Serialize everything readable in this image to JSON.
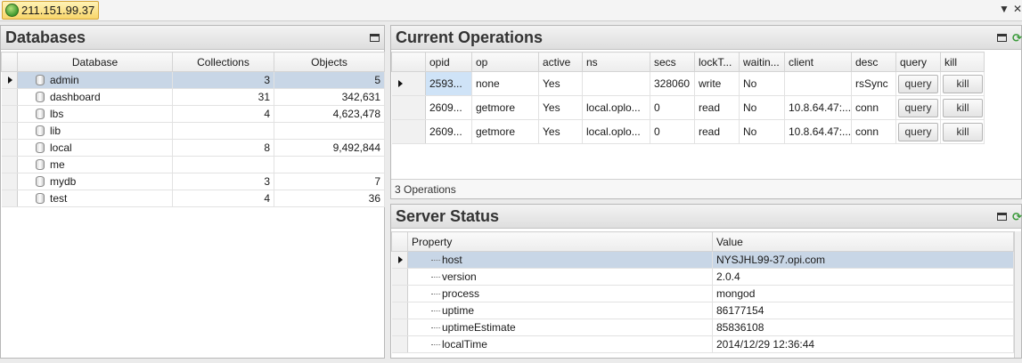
{
  "server": {
    "address": "211.151.99.37"
  },
  "databases": {
    "title": "Databases",
    "columns": [
      "Database",
      "Collections",
      "Objects"
    ],
    "rows": [
      {
        "name": "admin",
        "collections": "3",
        "objects": "5"
      },
      {
        "name": "dashboard",
        "collections": "31",
        "objects": "342,631"
      },
      {
        "name": "lbs",
        "collections": "4",
        "objects": "4,623,478"
      },
      {
        "name": "lib",
        "collections": "",
        "objects": ""
      },
      {
        "name": "local",
        "collections": "8",
        "objects": "9,492,844"
      },
      {
        "name": "me",
        "collections": "",
        "objects": ""
      },
      {
        "name": "mydb",
        "collections": "3",
        "objects": "7"
      },
      {
        "name": "test",
        "collections": "4",
        "objects": "36"
      }
    ]
  },
  "operations": {
    "title": "Current Operations",
    "columns": [
      "opid",
      "op",
      "active",
      "ns",
      "secs",
      "lockT...",
      "waitin...",
      "client",
      "desc",
      "query",
      "kill"
    ],
    "rows": [
      {
        "opid": "2593...",
        "op": "none",
        "active": "Yes",
        "ns": "",
        "secs": "328060",
        "lock": "write",
        "waiting": "No",
        "client": "",
        "desc": "rsSync",
        "query": "query",
        "kill": "kill"
      },
      {
        "opid": "2609...",
        "op": "getmore",
        "active": "Yes",
        "ns": "local.oplo...",
        "secs": "0",
        "lock": "read",
        "waiting": "No",
        "client": "10.8.64.47:...",
        "desc": "conn",
        "query": "query",
        "kill": "kill"
      },
      {
        "opid": "2609...",
        "op": "getmore",
        "active": "Yes",
        "ns": "local.oplo...",
        "secs": "0",
        "lock": "read",
        "waiting": "No",
        "client": "10.8.64.47:...",
        "desc": "conn",
        "query": "query",
        "kill": "kill"
      }
    ],
    "status": "3 Operations"
  },
  "server_status": {
    "title": "Server Status",
    "columns": [
      "Property",
      "Value"
    ],
    "rows": [
      {
        "property": "host",
        "value": "NYSJHL99-37.opi.com"
      },
      {
        "property": "version",
        "value": "2.0.4"
      },
      {
        "property": "process",
        "value": "mongod"
      },
      {
        "property": "uptime",
        "value": "86177154"
      },
      {
        "property": "uptimeEstimate",
        "value": "85836108"
      },
      {
        "property": "localTime",
        "value": "2014/12/29 12:36:44"
      }
    ]
  },
  "icons": {
    "server": "globe-icon",
    "database": "database-icon",
    "maximize": "maximize-icon",
    "refresh": "refresh-icon",
    "row_pointer": "row-pointer-icon"
  },
  "colors": {
    "server_tab": "#f8d56a",
    "selection": "#c8d6e6",
    "panel_header": "#dedede"
  }
}
